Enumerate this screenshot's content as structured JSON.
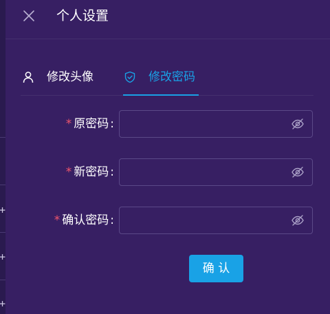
{
  "drawer": {
    "title": "个人设置"
  },
  "tabs": [
    {
      "label": "修改头像",
      "icon": "user-icon",
      "active": false
    },
    {
      "label": "修改密码",
      "icon": "shield-check-icon",
      "active": true
    }
  ],
  "form": {
    "fields": [
      {
        "label": "原密码",
        "required": true,
        "value": "",
        "icon": "eye-off-icon"
      },
      {
        "label": "新密码",
        "required": true,
        "value": "",
        "icon": "eye-off-icon"
      },
      {
        "label": "确认密码",
        "required": true,
        "value": "",
        "icon": "eye-off-icon"
      }
    ],
    "required_mark": "*",
    "colon": ":",
    "submit_label": "确 认"
  },
  "colors": {
    "background": "#371f63",
    "accent": "#19a2e6",
    "required": "#f0566c",
    "input_border": "#5b4988"
  }
}
